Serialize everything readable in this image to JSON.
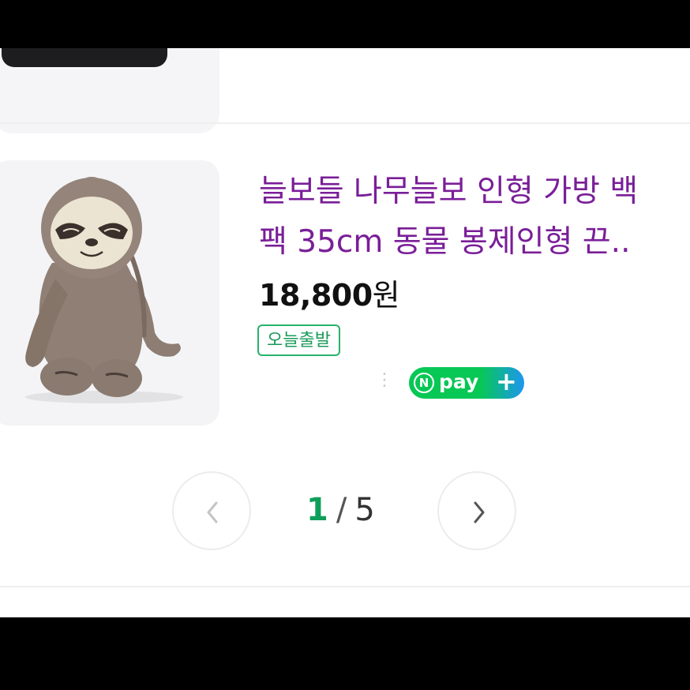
{
  "product": {
    "title_lines": [
      "늘보들 나무늘보 인형 가방 백",
      "팩 35cm 동물 봉제인형 끈.."
    ],
    "price_number": "18,800",
    "price_unit": "원",
    "badge": "오늘출발",
    "npay": {
      "n": "N",
      "word": "pay",
      "plus": "+"
    },
    "image_icon": "sloth-plush-image"
  },
  "pagination": {
    "current": "1",
    "separator": "/",
    "total": "5"
  },
  "colors": {
    "title": "#7a1e98",
    "accent_green": "#0f9e5a",
    "badge_border": "#26b36a",
    "npay_green": "#07c755",
    "npay_blue": "#1e96f0"
  }
}
